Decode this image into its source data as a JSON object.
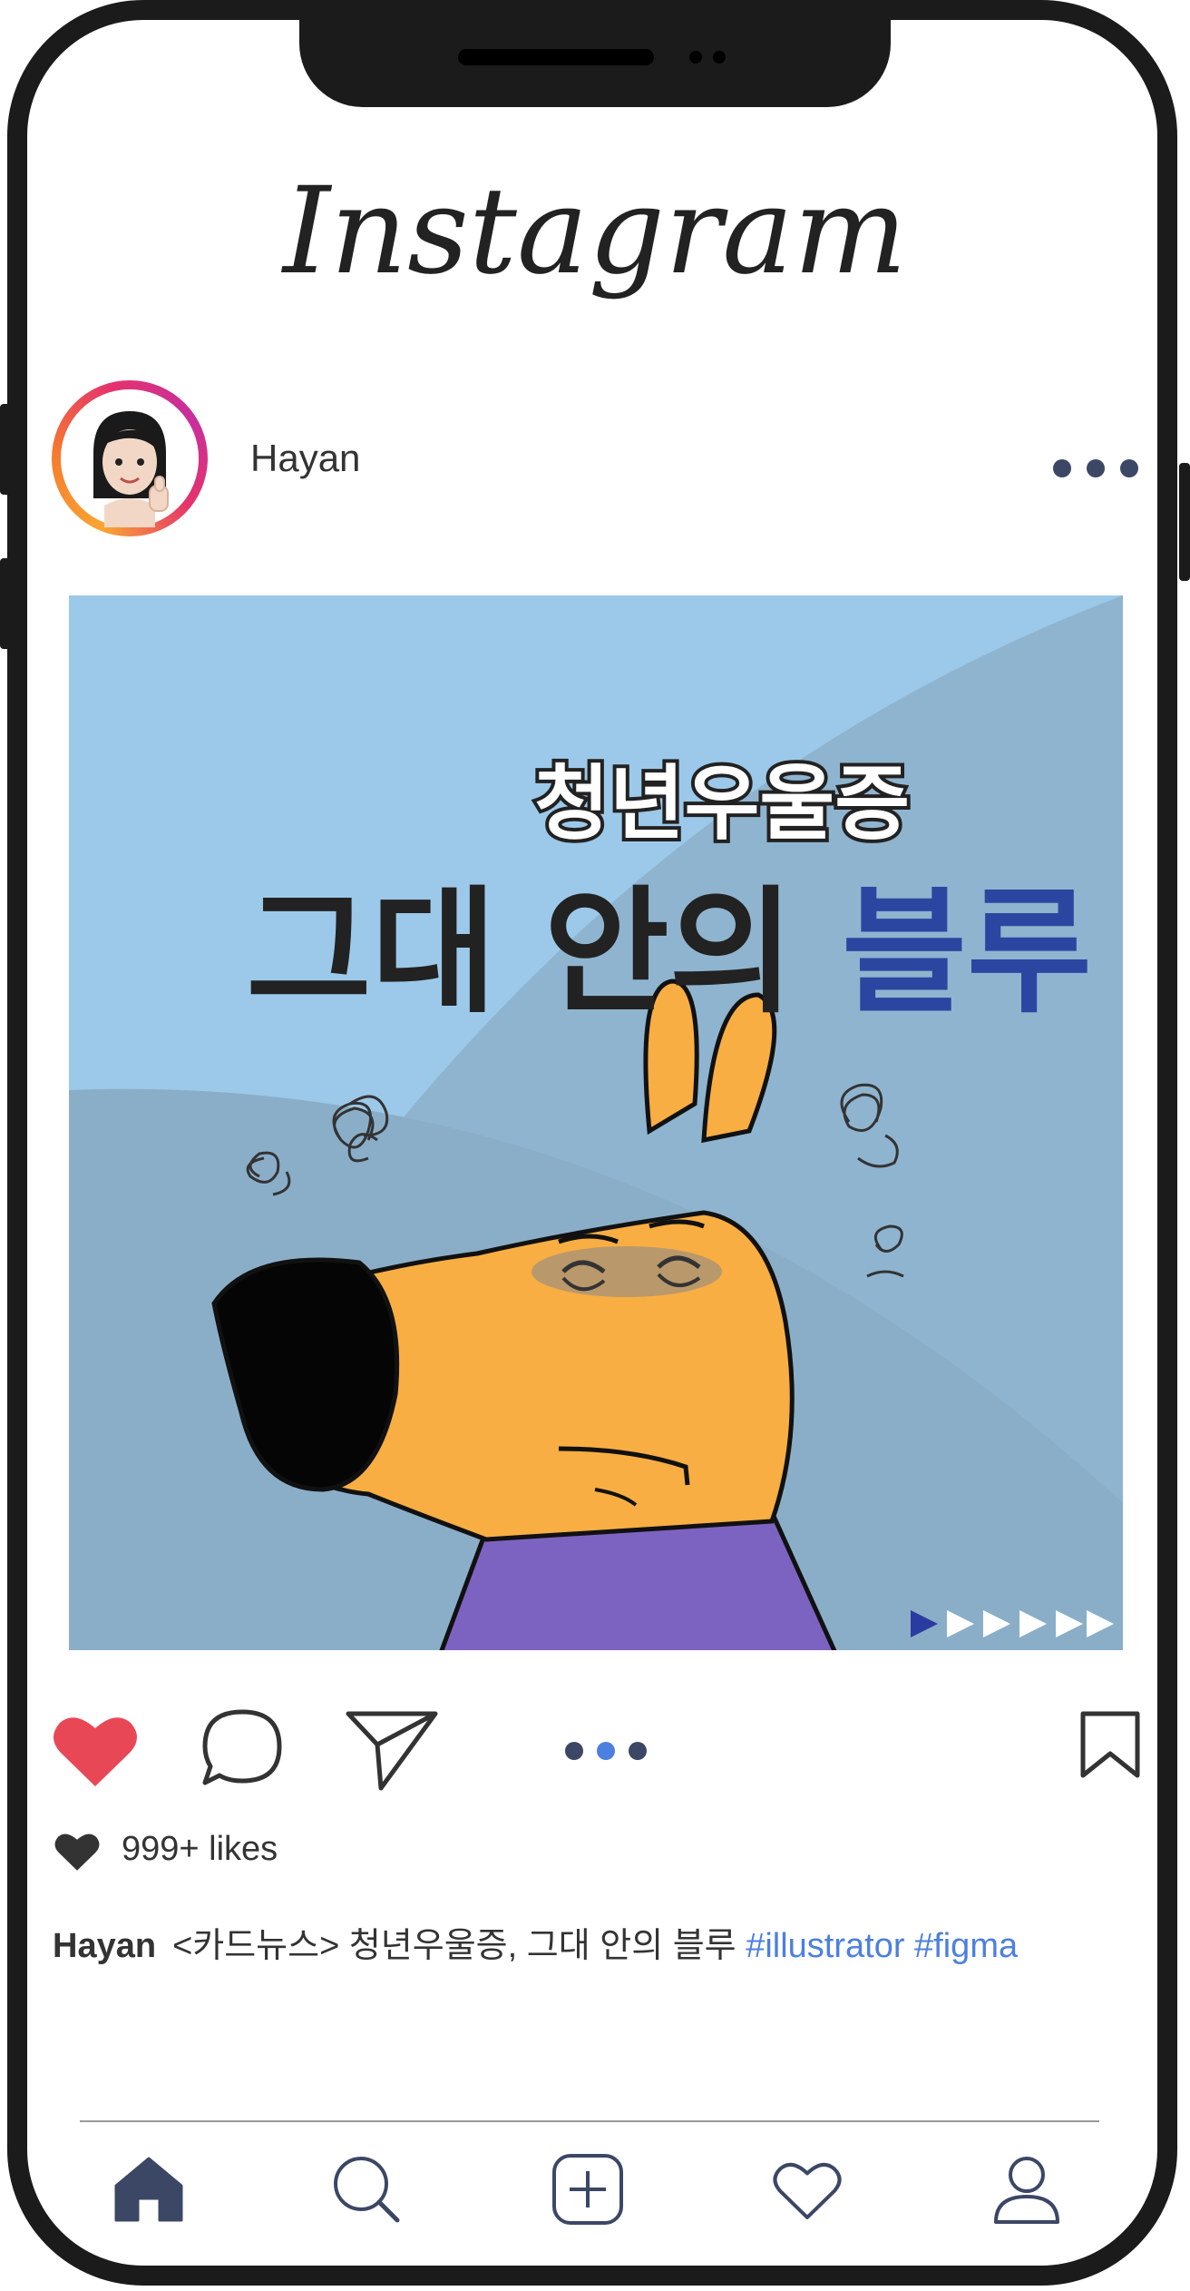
{
  "app": {
    "logo": "Instagram"
  },
  "post": {
    "username": "Hayan",
    "image": {
      "subtitle": "청년우울증",
      "title_part1": "그대 안의 ",
      "title_part2": "블루"
    },
    "carousel": {
      "count": 3,
      "active": 2
    },
    "slides_indicator": {
      "count": 6,
      "active": 1
    },
    "likes": "999+ likes",
    "caption": {
      "username": "Hayan",
      "text": "<카드뉴스> 청년우울증, 그대 안의 블루 ",
      "hashtags": "#illustrator #figma"
    }
  },
  "colors": {
    "like_red": "#e84856",
    "hashtag_blue": "#4d7fe0",
    "nav_navy": "#3c4766",
    "image_bg": "#9cc9e9",
    "title_blue": "#2b46a0"
  },
  "icons": [
    "heart-icon",
    "comment-icon",
    "share-icon",
    "bookmark-icon",
    "more-icon",
    "home-icon",
    "search-icon",
    "add-post-icon",
    "activity-heart-icon",
    "profile-icon"
  ]
}
